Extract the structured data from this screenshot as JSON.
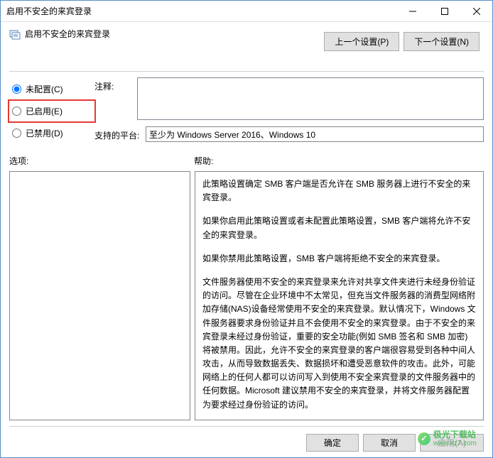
{
  "window": {
    "title": "启用不安全的来宾登录"
  },
  "header": {
    "title": "启用不安全的来宾登录"
  },
  "nav": {
    "prev": "上一个设置(P)",
    "next": "下一个设置(N)"
  },
  "radios": {
    "not_configured": "未配置(C)",
    "enabled": "已启用(E)",
    "disabled": "已禁用(D)"
  },
  "labels": {
    "comment": "注释:",
    "platform": "支持的平台:",
    "options": "选项:",
    "help": "帮助:"
  },
  "fields": {
    "comment": "",
    "platform": "至少为 Windows Server 2016、Windows 10"
  },
  "help": {
    "p1": "此策略设置确定 SMB 客户端是否允许在 SMB 服务器上进行不安全的来宾登录。",
    "p2": "如果你启用此策略设置或者未配置此策略设置，SMB 客户端将允许不安全的来宾登录。",
    "p3": "如果你禁用此策略设置，SMB 客户端将拒绝不安全的来宾登录。",
    "p4": "文件服务器使用不安全的来宾登录来允许对共享文件夹进行未经身份验证的访问。尽管在企业环境中不太常见，但充当文件服务器的消费型网络附加存储(NAS)设备经常使用不安全的来宾登录。默认情况下，Windows 文件服务器要求身份验证并且不会使用不安全的来宾登录。由于不安全的来宾登录未经过身份验证，重要的安全功能(例如 SMB 签名和 SMB 加密)将被禁用。因此，允许不安全的来宾登录的客户端很容易受到各种中间人攻击，从而导致数据丢失、数据损坏和遭受恶意软件的攻击。此外，可能网络上的任何人都可以访问写入到使用不安全来宾登录的文件服务器中的任何数据。Microsoft 建议禁用不安全的来宾登录，并将文件服务器配置为要求经过身份验证的访问。"
  },
  "footer": {
    "ok": "确定",
    "cancel": "取消",
    "apply": "应用(A)"
  },
  "watermark": {
    "name": "极光下载站",
    "url": "www.xz7.com"
  }
}
